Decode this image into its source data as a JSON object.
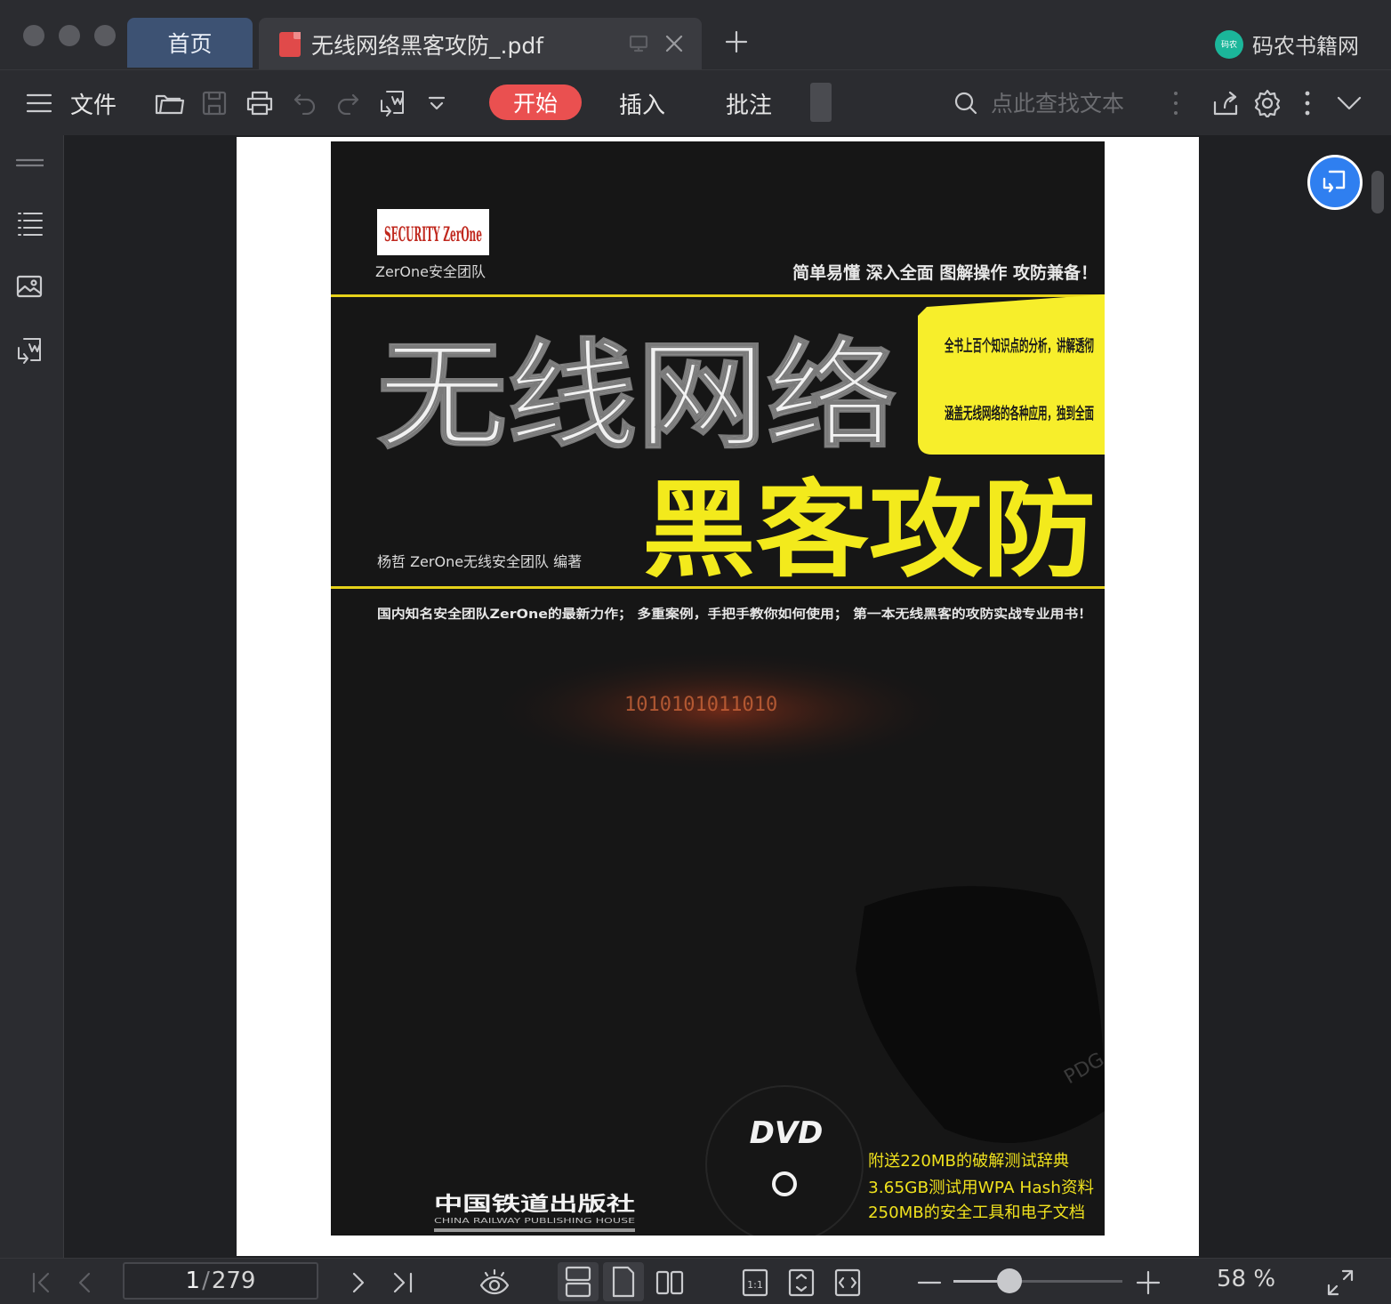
{
  "window": {
    "tabs": [
      {
        "label": "首页",
        "active": false
      },
      {
        "label": "无线网络黑客攻防_.pdf",
        "active": true
      }
    ],
    "brand": {
      "logo_text": "码农",
      "name": "码农书籍网"
    }
  },
  "toolbar": {
    "file_label": "文件",
    "tabs": [
      {
        "label": "开始",
        "active": true
      },
      {
        "label": "插入",
        "active": false
      },
      {
        "label": "批注",
        "active": false
      }
    ],
    "search_placeholder": "点此查找文本",
    "accent_color": "#ea5050"
  },
  "document": {
    "cover": {
      "logo_brand": "SECURITY ZerOne",
      "team": "ZerOne安全团队",
      "slogan": "简单易懂  深入全面  图解操作  攻防兼备！",
      "title_line1": "无线网络",
      "title_line2": "黑客攻防",
      "bullets": [
        "全书上百个知识点的分析，讲解透彻",
        "涵盖无线网络的各种应用，独到全面"
      ],
      "authors": "杨哲  ZerOne无线安全团队  编著",
      "tagline": "国内知名安全团队ZerOne的最新力作；  多重案例，手把手教你如何使用；  第一本无线黑客的攻防实战专业用书！",
      "binary_text": "1010101011010",
      "dvd_label": "DVD",
      "extras": [
        "附送220MB的破解测试辞典",
        "3.65GB测试用WPA Hash资料",
        "250MB的安全工具和电子文档"
      ],
      "publisher": "中国铁道出版社",
      "publisher_en": "CHINA RAILWAY PUBLISHING HOUSE",
      "watermark": "PDG"
    }
  },
  "statusbar": {
    "current_page": "1",
    "page_separator": "/",
    "total_pages": "279",
    "zoom_percent": 58,
    "zoom_label": "58 %"
  }
}
